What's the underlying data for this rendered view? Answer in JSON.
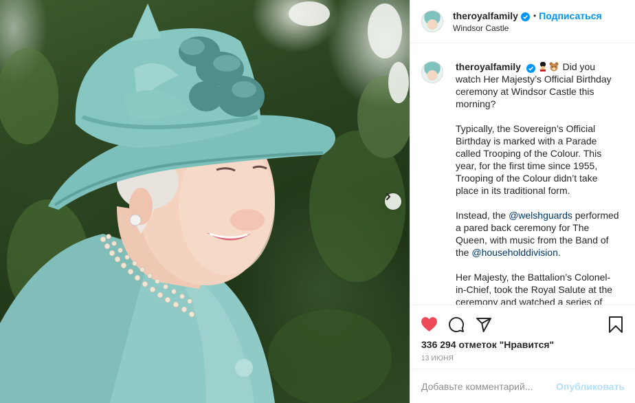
{
  "post": {
    "username": "theroyalfamily",
    "location": "Windsor Castle",
    "follow_label": "Подписаться",
    "separator": "•"
  },
  "caption": {
    "username": "theroyalfamily",
    "emojis": [
      "guardsman-emoji",
      "bear-emoji"
    ],
    "p1": "Did you watch Her Majesty’s Official Birthday ceremony at Windsor Castle this morning?",
    "p2": "Typically, the Sovereign’s Official Birthday is marked with a Parade called Trooping of the Colour. This year, for the first time since 1955, Trooping of the Colour didn’t take place in its traditional form.",
    "p3_pre": "Instead, the ",
    "p3_mention1": "@welshguards",
    "p3_mid": " performed a pared back ceremony for The Queen, with music from the Band of the ",
    "p3_mention2": "@householddivision",
    "p3_post": ".",
    "p4": "Her Majesty, the Battalion’s Colonel-in-Chief, took the Royal Salute at the ceremony and watched a series of"
  },
  "stats": {
    "likes": "336 294 отметок \"Нравится\"",
    "date": "13 ИЮНЯ"
  },
  "comment": {
    "placeholder": "Добавьте комментарий...",
    "publish_label": "Опубликовать"
  },
  "colors": {
    "accent": "#0095f6",
    "like_red": "#ed4956",
    "publish_disabled": "#b2dffc",
    "mention": "#00376b",
    "hat_teal": "#7dbfba"
  }
}
